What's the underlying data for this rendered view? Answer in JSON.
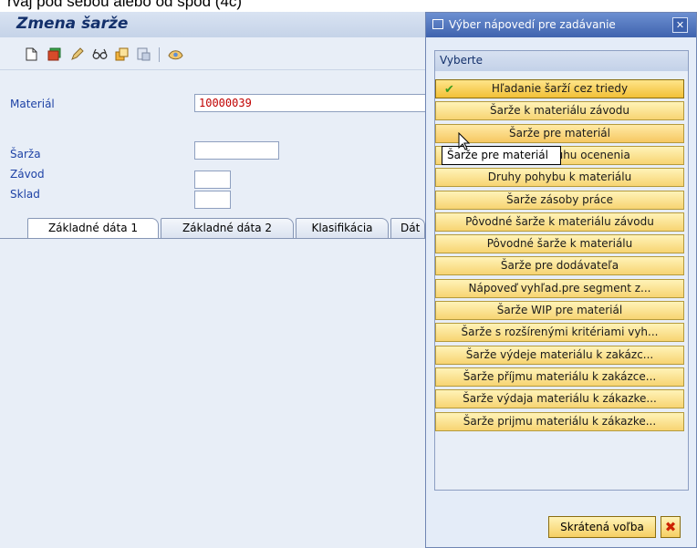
{
  "top_caption": "rvaj pod sebou alebo od spod (4c)",
  "window": {
    "title": "Zmena šarže"
  },
  "toolbar": {
    "icons": [
      "new-document-icon",
      "save-icon",
      "change-pencil-icon",
      "display-glasses-icon",
      "copy-icon",
      "other-icon",
      "where-used-icon"
    ]
  },
  "form": {
    "material_label": "Materiál",
    "material_value": "10000039",
    "batch_label": "Šarža",
    "plant_label": "Závod",
    "storage_label": "Sklad"
  },
  "tabs": [
    {
      "label": "Základné dáta 1"
    },
    {
      "label": "Základné dáta 2"
    },
    {
      "label": "Klasifikácia"
    },
    {
      "label": "Dát"
    }
  ],
  "popup": {
    "title": "Výber nápovedí pre zadávanie",
    "group_title": "Vyberte",
    "options": [
      "Hľadanie šarží cez triedy",
      "Šarže k materiálu závodu",
      "Šarže pre materiál",
      "Šarže pre druhu ocenenia",
      "Druhy pohybu k materiálu",
      "Šarže zásoby práce",
      "Pôvodné šarže k materiálu závodu",
      "Pôvodné šarže k materiálu",
      "Šarže pre dodávateľa",
      "Nápoveď vyhľad.pre segment z...",
      "Šarže WIP pre materiál",
      "Šarže s rozšírenými kritériami vyh...",
      "Šarže výdeje materiálu k zakázc...",
      "Šarže příjmu materiálu k zakázce...",
      "Šarže výdaja materiálu k zákazke...",
      "Šarže prĳmu materiálu k zákazke..."
    ],
    "short_list_label": "Skrátená voľba"
  },
  "tooltip": "Šarže pre materiál"
}
